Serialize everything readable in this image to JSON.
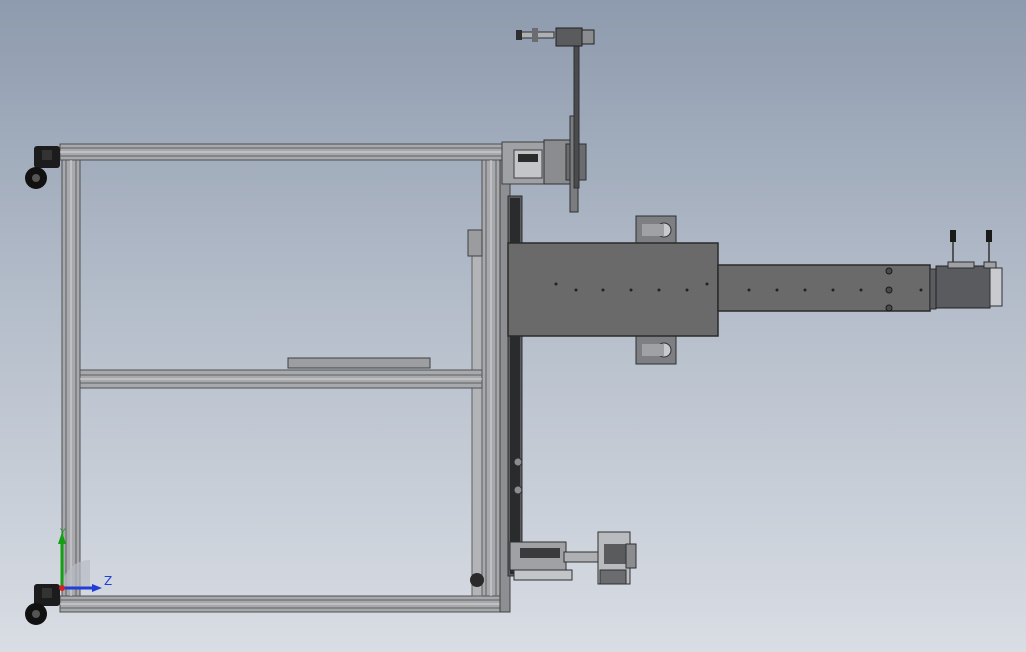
{
  "viewport": {
    "background_top": "#8e9bae",
    "background_bottom": "#d9dde4"
  },
  "colors": {
    "frame_metal": "#a7a9ac",
    "frame_dark": "#56585a",
    "housing_gray": "#6a6a6a",
    "black_part": "#1c1c1c",
    "axis_z": "#1f3fd6",
    "axis_y": "#13a013",
    "axis_x": "#d62020"
  },
  "triad": {
    "z_label": "Z",
    "y_label": "Y"
  },
  "icons": {
    "triad": "coordinate-triad-icon",
    "caster": "caster-wheel-icon",
    "motor": "servo-motor-icon",
    "cable": "cable-connector-icon"
  }
}
